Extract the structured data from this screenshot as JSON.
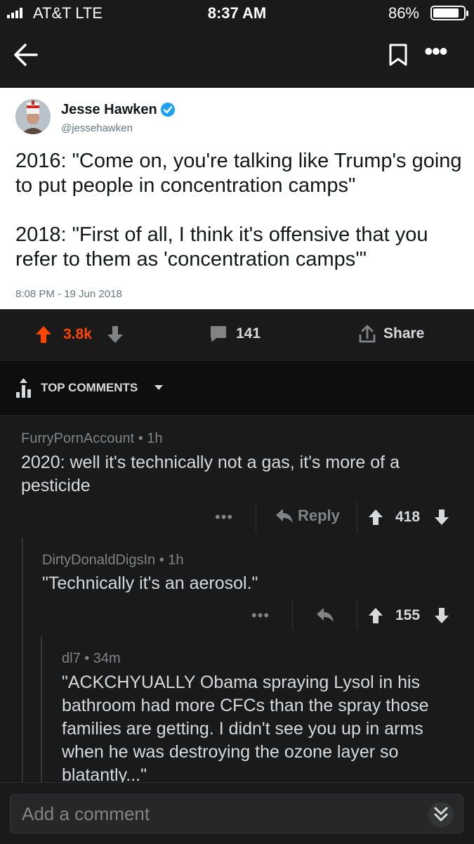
{
  "status_bar": {
    "carrier": "AT&T  LTE",
    "time": "8:37 AM",
    "battery": "86%",
    "battery_level": 0.86
  },
  "nav": {
    "back_icon": "arrow-left-icon",
    "bookmark_icon": "bookmark-icon",
    "more_label": "•••"
  },
  "tweet": {
    "name": "Jesse Hawken",
    "handle": "@jessehawken",
    "text": "2016: \"Come on, you're talking like Trump's going to put people in concentration camps\"\n\n2018: \"First of all, I think it's offensive that you refer to them as 'concentration camps'\"",
    "timestamp": "8:08 PM - 19 Jun 2018"
  },
  "post_actions": {
    "score": "3.8k",
    "comments": "141",
    "share": "Share"
  },
  "sort": {
    "label": "TOP COMMENTS"
  },
  "comments": [
    {
      "author": "FurryPornAccount • 1h",
      "body": "2020: well it's technically not a gas, it's more of a pesticide",
      "reply_label": "Reply",
      "score": "418",
      "more": "•••"
    },
    {
      "author": "DirtyDonaldDigsIn • 1h",
      "body": "\"Technically it's an aerosol.\"",
      "score": "155",
      "more": "•••"
    },
    {
      "author": "dl7 • 34m",
      "body": "\"ACKCHYUALLY Obama spraying Lysol in his bathroom had more CFCs than the spray those families are getting. I didn't see you up in arms when he was destroying the ozone layer so blatantly...\""
    }
  ],
  "composer": {
    "placeholder": "Add a comment"
  },
  "colors": {
    "accent": "#ff4500",
    "background": "#1a1a1b",
    "text": "#d7dadc",
    "muted": "#818384",
    "verified": "#1da1f2"
  }
}
